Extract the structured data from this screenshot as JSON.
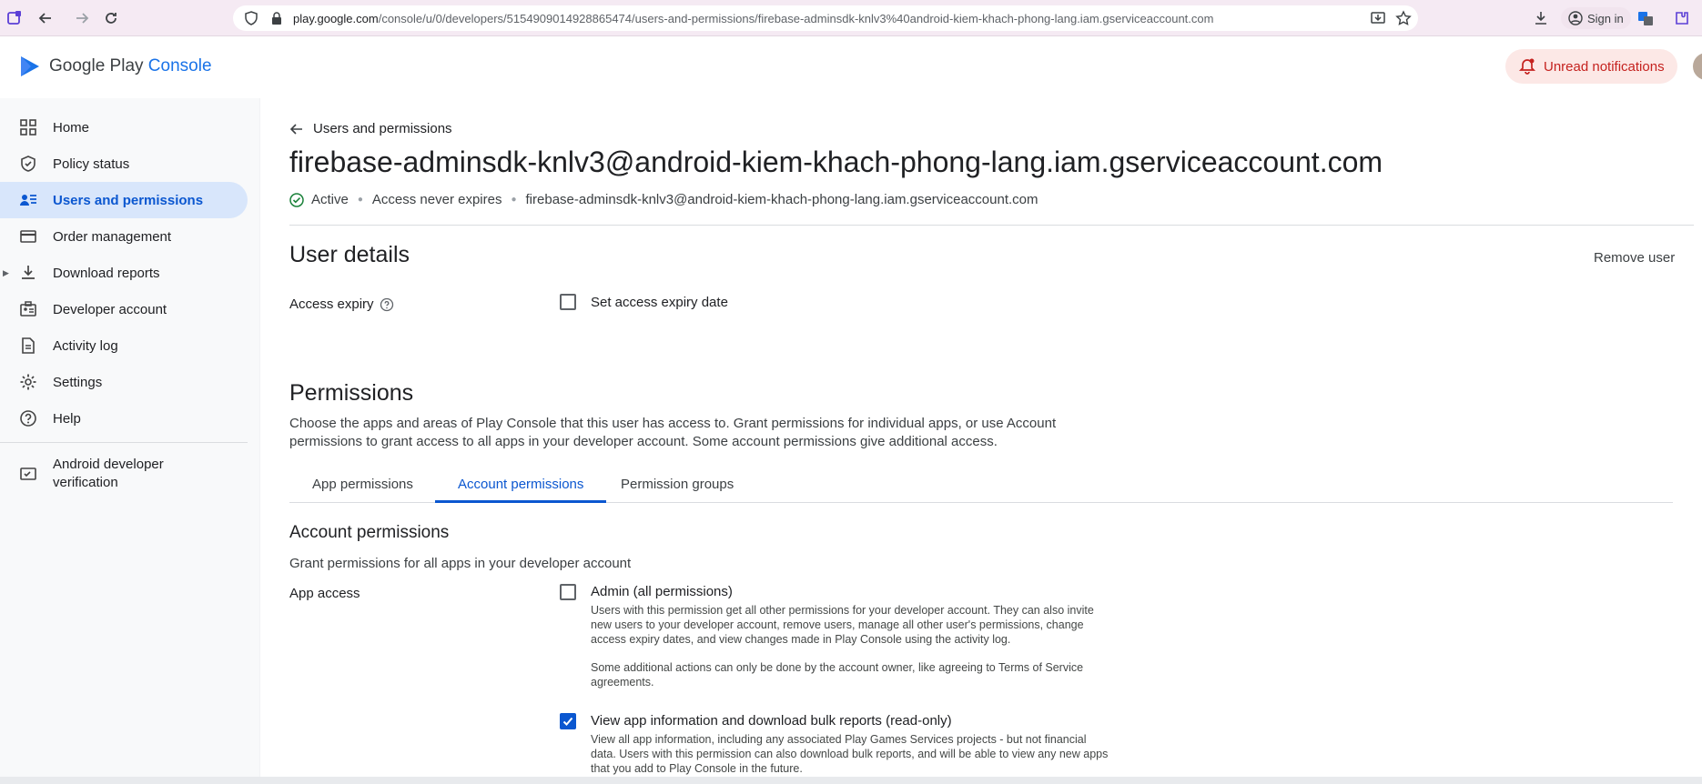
{
  "browser": {
    "url_host": "play.google.com",
    "url_path": "/console/u/0/developers/5154909014928865474/users-and-permissions/firebase-adminsdk-knlv3%40android-kiem-khach-phong-lang.iam.gserviceaccount.com",
    "signin_label": "Sign in"
  },
  "header": {
    "logo_primary": "Google Play ",
    "logo_accent": "Console",
    "notifications_label": "Unread notifications"
  },
  "sidebar": {
    "items": [
      {
        "label": "Home",
        "icon": "grid-icon"
      },
      {
        "label": "Policy status",
        "icon": "shield-icon"
      },
      {
        "label": "Users and permissions",
        "icon": "users-list-icon"
      },
      {
        "label": "Order management",
        "icon": "credit-card-icon"
      },
      {
        "label": "Download reports",
        "icon": "download-icon"
      },
      {
        "label": "Developer account",
        "icon": "badge-icon"
      },
      {
        "label": "Activity log",
        "icon": "document-icon"
      },
      {
        "label": "Settings",
        "icon": "gear-icon"
      },
      {
        "label": "Help",
        "icon": "help-icon"
      },
      {
        "label": "Android developer verification",
        "icon": "verification-icon"
      }
    ]
  },
  "main": {
    "back_label": "Users and permissions",
    "title": "firebase-adminsdk-knlv3@android-kiem-khach-phong-lang.iam.gserviceaccount.com",
    "status": "Active",
    "access": "Access never expires",
    "email": "firebase-adminsdk-knlv3@android-kiem-khach-phong-lang.iam.gserviceaccount.com",
    "user_details_title": "User details",
    "remove_user": "Remove user",
    "access_expiry_label": "Access expiry",
    "set_expiry_label": "Set access expiry date",
    "permissions_title": "Permissions",
    "permissions_desc": "Choose the apps and areas of Play Console that this user has access to. Grant permissions for individual apps, or use Account permissions to grant access to all apps in your developer account. Some account permissions give additional access.",
    "tabs": [
      {
        "label": "App permissions"
      },
      {
        "label": "Account permissions"
      },
      {
        "label": "Permission groups"
      }
    ],
    "account_permissions_title": "Account permissions",
    "account_permissions_desc": "Grant permissions for all apps in your developer account",
    "app_access_label": "App access",
    "admin_label": "Admin (all permissions)",
    "admin_desc_1": "Users with this permission get all other permissions for your developer account. They can also invite new users to your developer account, remove users, manage all other user's permissions, change access expiry dates, and view changes made in Play Console using the activity log.",
    "admin_desc_2": "Some additional actions can only be done by the account owner, like agreeing to Terms of Service agreements.",
    "view_app_label": "View app information and download bulk reports (read-only)",
    "view_app_desc": "View all app information, including any associated Play Games Services projects - but not financial data. Users with this permission can also download bulk reports, and will be able to view any new apps that you add to Play Console in the future."
  },
  "colors": {
    "accent": "#0b57d0",
    "active_nav_bg": "#d8e6fb",
    "notification_bg": "#fce8e6",
    "status_green": "#188038"
  }
}
